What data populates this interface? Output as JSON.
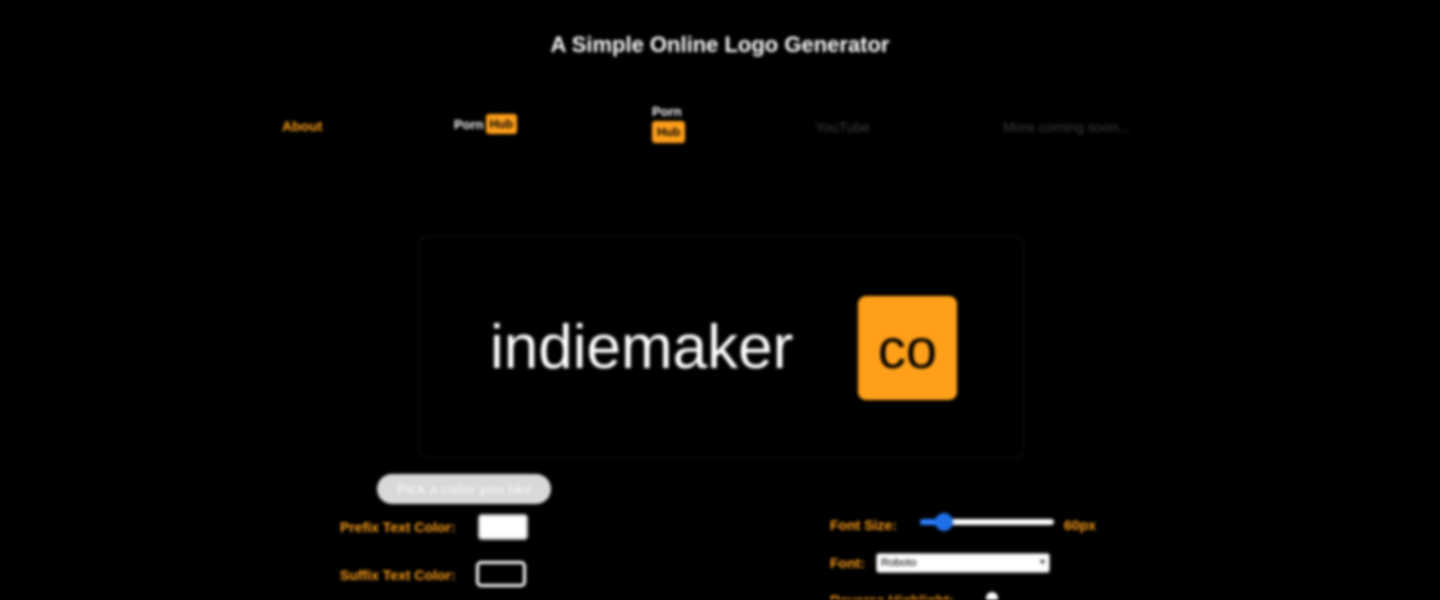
{
  "header": {
    "title": "A Simple Online Logo Generator"
  },
  "nav": {
    "about": "About",
    "style_horizontal": {
      "prefix": "Porn",
      "suffix": "Hub"
    },
    "style_vertical": {
      "prefix": "Porn",
      "suffix": "Hub"
    },
    "youtube": "YouTube",
    "more": "More coming soon..."
  },
  "preview": {
    "prefix_text": "indiemaker",
    "suffix_text": "co"
  },
  "controls": {
    "pick_color_label": "Pick a color you like",
    "prefix_color_label": "Prefix Text Color:",
    "suffix_color_label": "Suffix Text Color:",
    "font_size_label": "Font Size:",
    "font_size_value": "60px",
    "font_label": "Font:",
    "font_selected": "Roboto",
    "bottom_label": "Reverse Highlight:"
  },
  "colors": {
    "accent": "#ff9f1a",
    "background": "#000000",
    "prefix_text_color": "#ffffff",
    "suffix_text_color": "#000000"
  },
  "slider": {
    "font_size_fraction": 0.15
  }
}
